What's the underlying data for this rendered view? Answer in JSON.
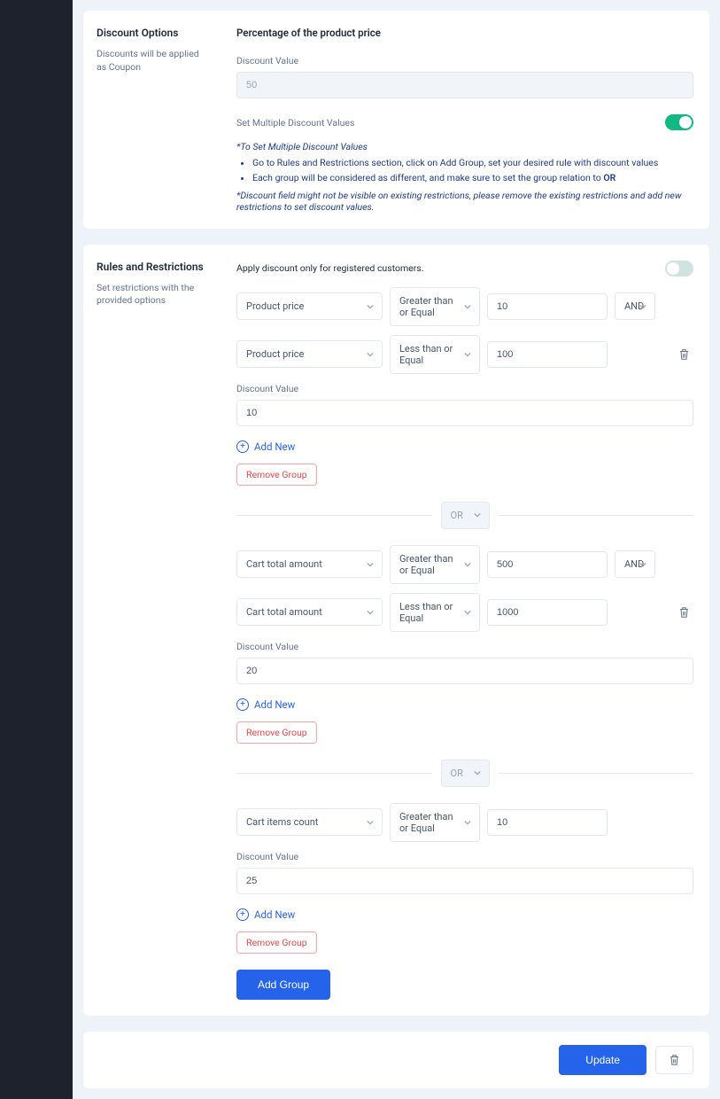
{
  "discount_options": {
    "title": "Discount Options",
    "subtitle": "Discounts will be applied as Coupon",
    "section_title": "Percentage of the product price",
    "discount_value_label": "Discount Value",
    "discount_value": "50",
    "multiple_label": "Set Multiple Discount Values",
    "note_title": "*To Set Multiple Discount Values",
    "note_bullet1": "Go to Rules and Restrictions section, click on Add Group, set your desired rule with discount values",
    "note_bullet2_a": "Each group will be considered as different, and make sure to set the group relation to ",
    "note_bullet2_b": "OR",
    "note_footer": "*Discount field might not be visible on existing restrictions, please remove the existing restrictions and add new restrictions to set discount values."
  },
  "rules": {
    "title": "Rules and Restrictions",
    "subtitle": "Set restrictions with the provided options",
    "registered_label": "Apply discount only for registered customers.",
    "discount_value_label": "Discount Value",
    "add_new_label": "Add New",
    "remove_group_label": "Remove Group",
    "or_label": "OR",
    "add_group_label": "Add Group",
    "groups": [
      {
        "rules": [
          {
            "field": "Product price",
            "op": "Greater than or Equal",
            "val": "10",
            "rel": "AND"
          },
          {
            "field": "Product price",
            "op": "Less than or Equal",
            "val": "100"
          }
        ],
        "discount": "10"
      },
      {
        "rules": [
          {
            "field": "Cart total amount",
            "op": "Greater than or Equal",
            "val": "500",
            "rel": "AND"
          },
          {
            "field": "Cart total amount",
            "op": "Less than or Equal",
            "val": "1000"
          }
        ],
        "discount": "20"
      },
      {
        "rules": [
          {
            "field": "Cart items count",
            "op": "Greater than or Equal",
            "val": "10"
          }
        ],
        "discount": "25"
      }
    ]
  },
  "footer": {
    "update_label": "Update"
  }
}
